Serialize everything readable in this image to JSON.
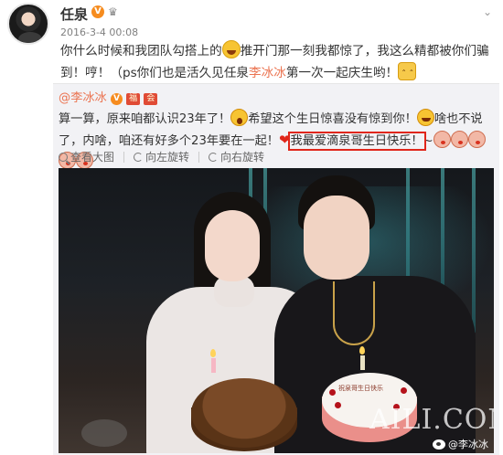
{
  "post": {
    "author": "任泉",
    "verified_label": "V",
    "timestamp": "2016-3-4 00:08",
    "text_1": "你什么时候和我团队勾搭上的",
    "text_2": "推开门那一刻我都惊了，我这么精都被你们骗到！哼！（ps你们也是活久见任泉",
    "mention": "李冰冰",
    "text_3": "第一次一起庆生哟！"
  },
  "repost": {
    "author": "@李冰冰",
    "text_1": "算一算，原来咱都认识23年了！",
    "text_2": "希望这个生日惊喜没有惊到你！",
    "text_3": "啥也不说了，内啥，咱还有好多个23年要在一起！",
    "highlighted": "我最爱滴泉哥生日快乐！",
    "tilde": "~"
  },
  "toolbar": {
    "view_large": "查看大图",
    "rotate_left": "向左旋转",
    "rotate_right": "向右旋转"
  },
  "image": {
    "watermark": "AILI.COM",
    "weibo_mark": "@李冰冰",
    "cake_text": "祝泉哥生日快乐"
  },
  "icons": {
    "verified": "v-badge-icon",
    "crown": "crown-icon",
    "menu": "chevron-down-icon",
    "zoom": "zoom-icon",
    "rotate_left": "rotate-left-icon",
    "rotate_right": "rotate-right-icon"
  },
  "colors": {
    "accent_link": "#eb7350",
    "verified": "#f68c1f",
    "highlight_box": "#e0261a",
    "repost_bg": "#f2f2f5"
  }
}
